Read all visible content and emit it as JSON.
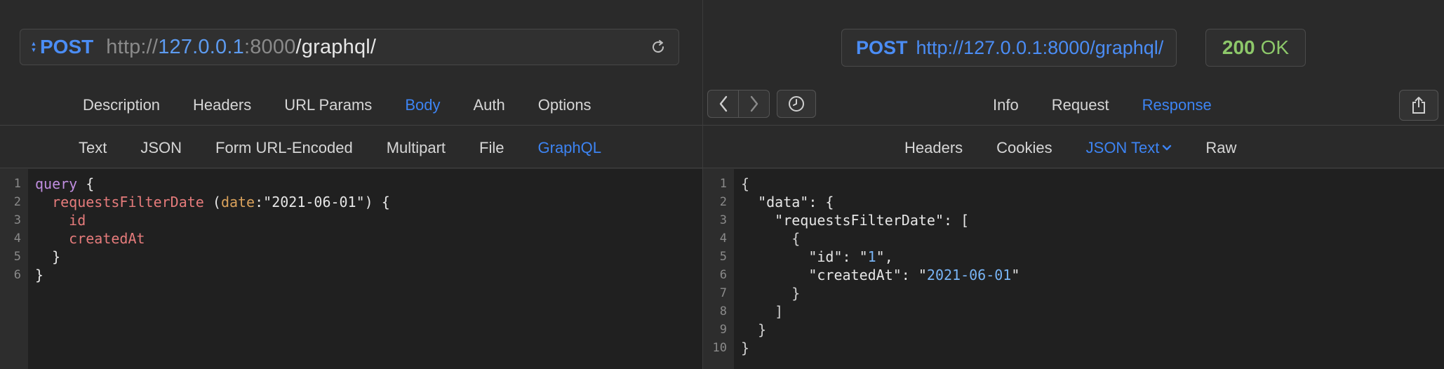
{
  "request": {
    "method": "POST",
    "url_scheme": "http://",
    "url_host": "127.0.0.1",
    "url_colon": ":",
    "url_port": "8000",
    "url_path": "/graphql/",
    "tabs": [
      "Description",
      "Headers",
      "URL Params",
      "Body",
      "Auth",
      "Options"
    ],
    "active_tab": "Body",
    "body_types": [
      "Text",
      "JSON",
      "Form URL-Encoded",
      "Multipart",
      "File",
      "GraphQL"
    ],
    "active_body_type": "GraphQL",
    "editor_line_numbers": [
      "1",
      "2",
      "3",
      "4",
      "5",
      "6"
    ],
    "query_lines": [
      [
        {
          "t": "query",
          "c": "kw"
        },
        {
          "t": " {",
          "c": "pun"
        }
      ],
      [
        {
          "t": "  ",
          "c": "pun"
        },
        {
          "t": "requestsFilterDate",
          "c": "fn"
        },
        {
          "t": " (",
          "c": "pun"
        },
        {
          "t": "date",
          "c": "arg"
        },
        {
          "t": ":\"2021-06-01\") {",
          "c": "str"
        }
      ],
      [
        {
          "t": "    ",
          "c": "pun"
        },
        {
          "t": "id",
          "c": "fn"
        }
      ],
      [
        {
          "t": "    ",
          "c": "pun"
        },
        {
          "t": "createdAt",
          "c": "fn"
        }
      ],
      [
        {
          "t": "  }",
          "c": "pun"
        }
      ],
      [
        {
          "t": "}",
          "c": "pun"
        }
      ]
    ]
  },
  "response": {
    "method": "POST",
    "url": "http://127.0.0.1:8000/graphql/",
    "status_code": "200",
    "status_text": "OK",
    "tabs": [
      "Info",
      "Request",
      "Response"
    ],
    "active_tab": "Response",
    "sub_tabs": [
      "Headers",
      "Cookies",
      "JSON Text",
      "Raw"
    ],
    "active_sub_tab": "JSON Text",
    "editor_line_numbers": [
      "1",
      "2",
      "3",
      "4",
      "5",
      "6",
      "7",
      "8",
      "9",
      "10"
    ],
    "json_lines": [
      [
        {
          "t": "{",
          "c": "jpun"
        }
      ],
      [
        {
          "t": "  \"data\": {",
          "c": "jkey"
        }
      ],
      [
        {
          "t": "    \"requestsFilterDate\": [",
          "c": "jkey"
        }
      ],
      [
        {
          "t": "      {",
          "c": "jpun"
        }
      ],
      [
        {
          "t": "        \"id\": \"",
          "c": "jkey"
        },
        {
          "t": "1",
          "c": "jstr"
        },
        {
          "t": "\",",
          "c": "jkey"
        }
      ],
      [
        {
          "t": "        \"createdAt\": \"",
          "c": "jkey"
        },
        {
          "t": "2021-06-01",
          "c": "jstr"
        },
        {
          "t": "\"",
          "c": "jkey"
        }
      ],
      [
        {
          "t": "      }",
          "c": "jpun"
        }
      ],
      [
        {
          "t": "    ]",
          "c": "jpun"
        }
      ],
      [
        {
          "t": "  }",
          "c": "jpun"
        }
      ],
      [
        {
          "t": "}",
          "c": "jpun"
        }
      ]
    ]
  },
  "icons": {
    "reload": "reload-icon",
    "back": "chevron-left-icon",
    "forward": "chevron-right-icon",
    "history": "clock-icon",
    "share": "share-icon",
    "method_selector": "up-down-arrows-icon",
    "dropdown": "chevron-down-icon"
  },
  "colors": {
    "accent": "#3d84f3",
    "status_ok": "#8dc86a"
  }
}
